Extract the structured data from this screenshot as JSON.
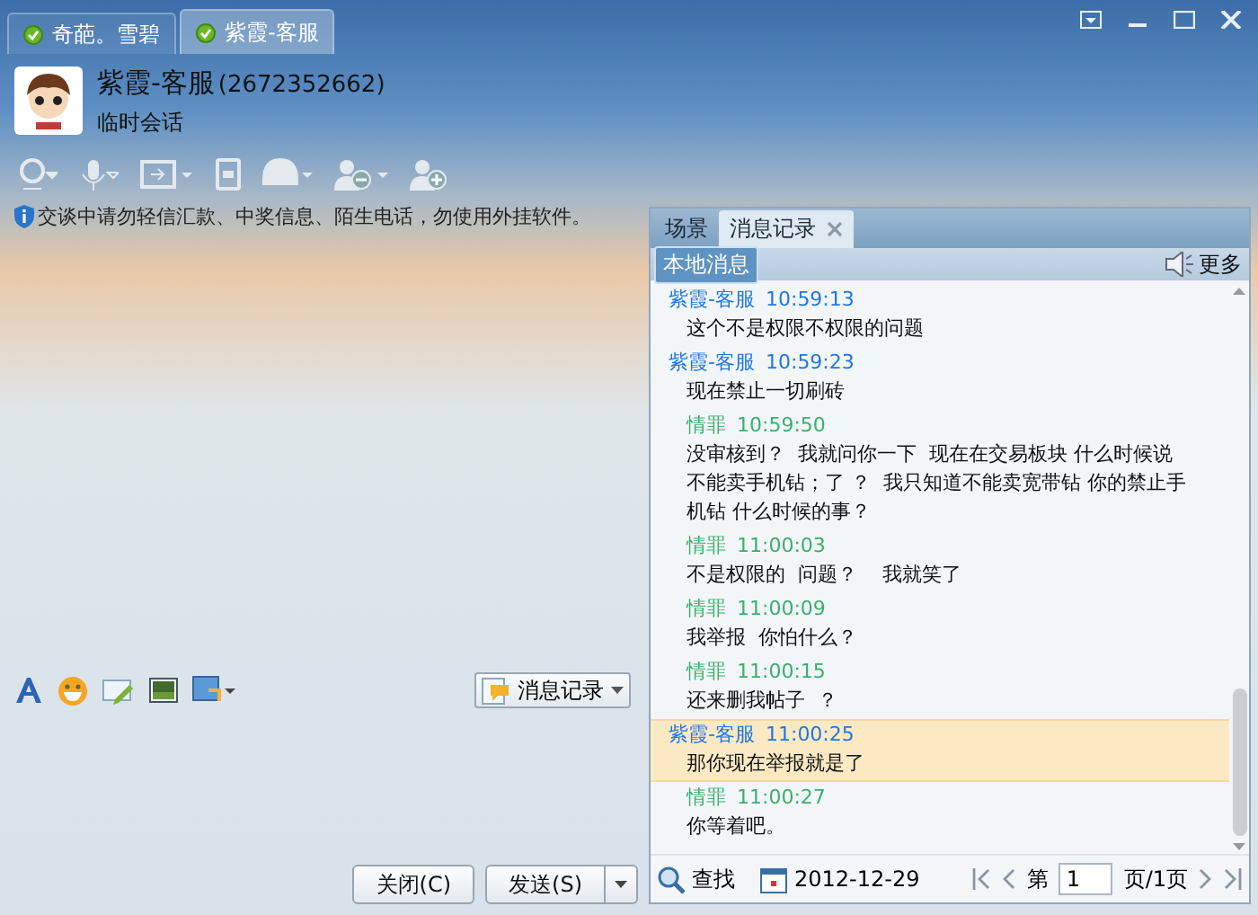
{
  "tabs": [
    {
      "label": "奇葩。雪碧",
      "selected": false
    },
    {
      "label": "紫霞-客服",
      "selected": true
    }
  ],
  "contact": {
    "name": "紫霞-客服",
    "number": "(2672352662)",
    "status": "临时会话"
  },
  "notice": "交谈中请勿轻信汇款、中奖信息、陌生电话，勿使用外挂软件。",
  "history_button": "消息记录",
  "buttons": {
    "close": "关闭(C)",
    "send": "发送(S)"
  },
  "history": {
    "tabs": [
      {
        "label": "场景",
        "selected": false
      },
      {
        "label": "消息记录",
        "selected": true
      }
    ],
    "filter": "本地消息",
    "more": "更多",
    "messages": [
      {
        "sender": "紫霞-客服",
        "time": "10:59:13",
        "text": "这个不是权限不权限的问题",
        "kind": "contact",
        "selected": false
      },
      {
        "sender": "紫霞-客服",
        "time": "10:59:23",
        "text": "现在禁止一切刷砖",
        "kind": "contact",
        "selected": false
      },
      {
        "sender": "情罪",
        "time": "10:59:50",
        "text": "没审核到？  我就问你一下  现在在交易板块 什么时候说不能卖手机钻；了 ？  我只知道不能卖宽带钻 你的禁止手机钻 什么时候的事？",
        "kind": "me",
        "selected": false
      },
      {
        "sender": "情罪",
        "time": "11:00:03",
        "text": "不是权限的  问题？    我就笑了",
        "kind": "me",
        "selected": false
      },
      {
        "sender": "情罪",
        "time": "11:00:09",
        "text": "我举报  你怕什么？",
        "kind": "me",
        "selected": false
      },
      {
        "sender": "情罪",
        "time": "11:00:15",
        "text": "还来删我帖子  ？",
        "kind": "me",
        "selected": false
      },
      {
        "sender": "紫霞-客服",
        "time": "11:00:25",
        "text": "那你现在举报就是了",
        "kind": "contact",
        "selected": true
      },
      {
        "sender": "情罪",
        "time": "11:00:27",
        "text": "你等着吧。",
        "kind": "me",
        "selected": false
      }
    ],
    "search": "查找",
    "date": "2012-12-29",
    "page_prefix": "第",
    "page": "1",
    "page_suffix": "页/1页"
  }
}
